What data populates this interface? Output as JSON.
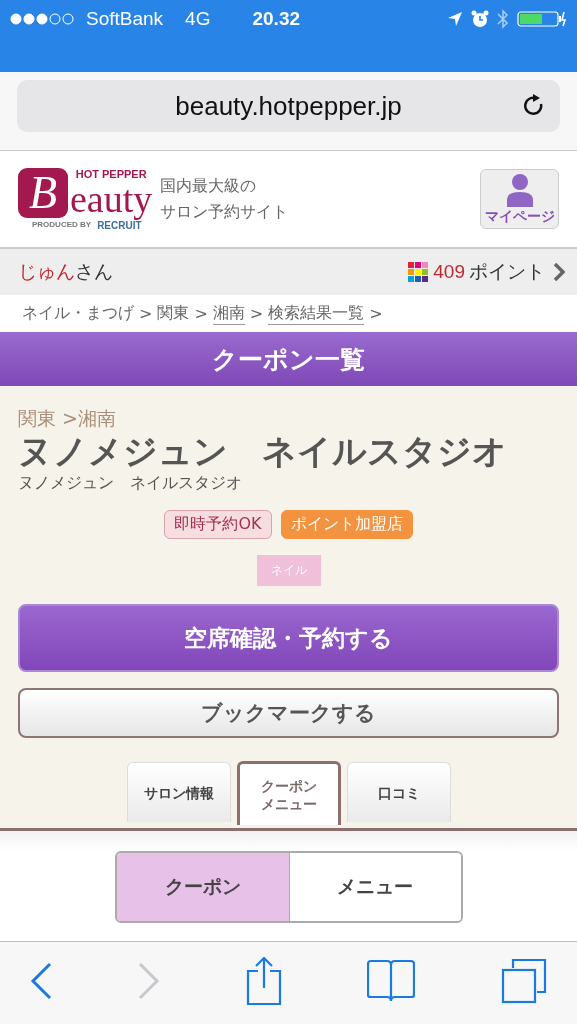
{
  "status_bar": {
    "carrier": "SoftBank",
    "network": "4G",
    "time": "20.32"
  },
  "address_bar": {
    "url": "beauty.hotpepper.jp"
  },
  "header": {
    "logo": {
      "brand_top": "HOT PEPPER",
      "letter": "B",
      "word": "eauty",
      "produced_by": "PRODUCED BY",
      "company": "RECRUIT"
    },
    "tagline": [
      "国内最大級の",
      "サロン予約サイト"
    ],
    "mypage_button": "マイページ"
  },
  "user_bar": {
    "name": "じゅん",
    "honorific": "さん",
    "points": "409",
    "points_label": "ポイント"
  },
  "breadcrumb": [
    {
      "label": "ネイル・まつげ",
      "linked": false,
      "sep": ">"
    },
    {
      "label": "関東",
      "linked": false,
      "sep": ">"
    },
    {
      "label": "湘南",
      "linked": true,
      "sep": ">"
    },
    {
      "label": "検索結果一覧",
      "linked": true,
      "sep": ">"
    }
  ],
  "page_title": "クーポン一覧",
  "salon": {
    "area": "関東 >湘南",
    "name": "ヌノメジュン　ネイルスタジオ",
    "name_sub": "ヌノメジュン　ネイルスタジオ",
    "badges": [
      {
        "label": "即時予約OK",
        "kind": "instant"
      },
      {
        "label": "ポイント加盟店",
        "kind": "points"
      }
    ],
    "tag": "ネイル",
    "reserve_button": "空席確認・予約する",
    "bookmark_button": "ブックマークする"
  },
  "tabs": [
    {
      "lines": [
        "サロン情報"
      ],
      "selected": false
    },
    {
      "lines": [
        "クーポン",
        "メニュー"
      ],
      "selected": true
    },
    {
      "lines": [
        "口コミ"
      ],
      "selected": false
    }
  ],
  "segments": [
    {
      "label": "クーポン",
      "selected": true
    },
    {
      "label": "メニュー",
      "selected": false
    }
  ],
  "toolbar": [
    {
      "kind": "back",
      "disabled": false
    },
    {
      "kind": "forward",
      "disabled": true
    },
    {
      "kind": "share",
      "disabled": false
    },
    {
      "kind": "bookmarks",
      "disabled": false
    },
    {
      "kind": "tabs",
      "disabled": false
    }
  ]
}
